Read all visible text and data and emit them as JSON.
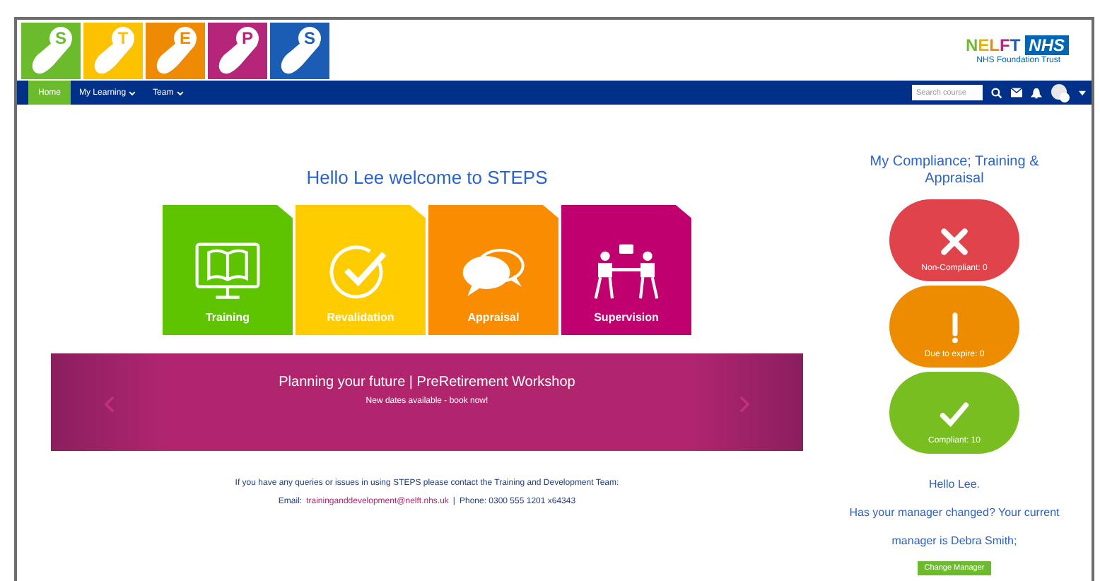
{
  "logo": {
    "tiles": [
      {
        "letter": "S",
        "color": "#6cbb2d"
      },
      {
        "letter": "T",
        "color": "#fcc200"
      },
      {
        "letter": "E",
        "color": "#ef8a05"
      },
      {
        "letter": "P",
        "color": "#b5267a"
      },
      {
        "letter": "S",
        "color": "#1b5cb5"
      }
    ]
  },
  "org_logo": {
    "name": "NELFT",
    "badge": "NHS",
    "subtitle": "NHS Foundation Trust"
  },
  "nav": {
    "items": [
      {
        "label": "Home",
        "selected": true,
        "dropdown": false
      },
      {
        "label": "My Learning",
        "selected": false,
        "dropdown": true
      },
      {
        "label": "Team",
        "selected": false,
        "dropdown": true
      }
    ],
    "search": {
      "placeholder": "Search course"
    }
  },
  "main": {
    "greeting": "Hello Lee welcome to STEPS",
    "tiles": [
      {
        "kind": "training",
        "label": "Training",
        "color": "#5ec400"
      },
      {
        "kind": "revalidation",
        "label": "Revalidation",
        "color": "#ffcc00"
      },
      {
        "kind": "appraisal",
        "label": "Appraisal",
        "color": "#f98c00"
      },
      {
        "kind": "supervision",
        "label": "Supervision",
        "color": "#c0006e"
      }
    ],
    "carousel": {
      "title": "Planning your future | PreRetirement Workshop",
      "subtitle": "New dates available - book now!"
    },
    "contact": {
      "text": "If you have any queries or issues in using STEPS please contact the Training and Development Team:",
      "email_label": "Email:",
      "email": "traininganddevelopment@nelft.nhs.uk",
      "separator": "|",
      "phone": "Phone: 0300 555 1201 x64343"
    }
  },
  "compliance": {
    "title": "My Compliance; Training & Appraisal",
    "statuses": [
      {
        "kind": "cross",
        "label": "Non-Compliant: 0",
        "color": "#e0434a"
      },
      {
        "kind": "exclaim",
        "label": "Due to expire: 0",
        "color": "#ee8c00"
      },
      {
        "kind": "check",
        "label": "Compliant: 10",
        "color": "#78be20"
      }
    ],
    "hello": "Hello Lee.",
    "manager_text": "Has your manager changed? Your current manager is Debra Smith;",
    "button": "Change Manager"
  }
}
